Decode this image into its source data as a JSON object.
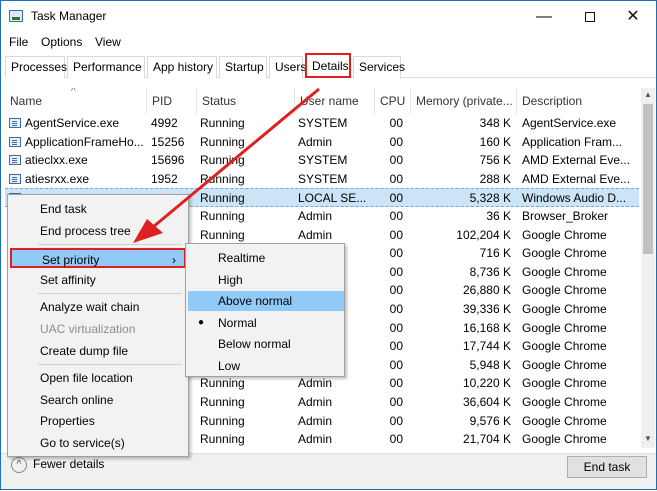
{
  "window": {
    "title": "Task Manager",
    "min": "—",
    "close": "✕"
  },
  "menu": [
    "File",
    "Options",
    "View"
  ],
  "tabs": [
    "Processes",
    "Performance",
    "App history",
    "Startup",
    "Users",
    "Details",
    "Services"
  ],
  "active_tab": "Details",
  "columns": [
    "Name",
    "PID",
    "Status",
    "User name",
    "CPU",
    "Memory (private...",
    "Description"
  ],
  "rows": [
    {
      "name": "AgentService.exe",
      "pid": "4992",
      "status": "Running",
      "user": "SYSTEM",
      "cpu": "00",
      "mem": "348 K",
      "desc": "AgentService.exe"
    },
    {
      "name": "ApplicationFrameHo...",
      "pid": "15256",
      "status": "Running",
      "user": "Admin",
      "cpu": "00",
      "mem": "160 K",
      "desc": "Application Fram..."
    },
    {
      "name": "atieclxx.exe",
      "pid": "15696",
      "status": "Running",
      "user": "SYSTEM",
      "cpu": "00",
      "mem": "756 K",
      "desc": "AMD External Eve..."
    },
    {
      "name": "atiesrxx.exe",
      "pid": "1952",
      "status": "Running",
      "user": "SYSTEM",
      "cpu": "00",
      "mem": "288 K",
      "desc": "AMD External Eve..."
    },
    {
      "name": "",
      "pid": "",
      "status": "Running",
      "user": "LOCAL SE...",
      "cpu": "00",
      "mem": "5,328 K",
      "desc": "Windows Audio D..."
    },
    {
      "name": "",
      "pid": "",
      "status": "Running",
      "user": "Admin",
      "cpu": "00",
      "mem": "36 K",
      "desc": "Browser_Broker"
    },
    {
      "name": "",
      "pid": "",
      "status": "Running",
      "user": "Admin",
      "cpu": "00",
      "mem": "102,204 K",
      "desc": "Google Chrome"
    },
    {
      "name": "",
      "pid": "",
      "status": "",
      "user": "",
      "cpu": "00",
      "mem": "716 K",
      "desc": "Google Chrome"
    },
    {
      "name": "",
      "pid": "",
      "status": "",
      "user": "",
      "cpu": "00",
      "mem": "8,736 K",
      "desc": "Google Chrome"
    },
    {
      "name": "",
      "pid": "",
      "status": "",
      "user": "",
      "cpu": "00",
      "mem": "26,880 K",
      "desc": "Google Chrome"
    },
    {
      "name": "",
      "pid": "",
      "status": "",
      "user": "",
      "cpu": "00",
      "mem": "39,336 K",
      "desc": "Google Chrome"
    },
    {
      "name": "",
      "pid": "",
      "status": "",
      "user": "",
      "cpu": "00",
      "mem": "16,168 K",
      "desc": "Google Chrome"
    },
    {
      "name": "",
      "pid": "",
      "status": "",
      "user": "",
      "cpu": "00",
      "mem": "17,744 K",
      "desc": "Google Chrome"
    },
    {
      "name": "",
      "pid": "",
      "status": "",
      "user": "",
      "cpu": "00",
      "mem": "5,948 K",
      "desc": "Google Chrome"
    },
    {
      "name": "",
      "pid": "",
      "status": "Running",
      "user": "Admin",
      "cpu": "00",
      "mem": "10,220 K",
      "desc": "Google Chrome"
    },
    {
      "name": "",
      "pid": "",
      "status": "Running",
      "user": "Admin",
      "cpu": "00",
      "mem": "36,604 K",
      "desc": "Google Chrome"
    },
    {
      "name": "",
      "pid": "",
      "status": "Running",
      "user": "Admin",
      "cpu": "00",
      "mem": "9,576 K",
      "desc": "Google Chrome"
    },
    {
      "name": "",
      "pid": "",
      "status": "Running",
      "user": "Admin",
      "cpu": "00",
      "mem": "21,704 K",
      "desc": "Google Chrome"
    }
  ],
  "selected_row": 4,
  "context_menu": [
    {
      "label": "End task"
    },
    {
      "label": "End process tree"
    },
    {
      "sep": true
    },
    {
      "label": "Set priority",
      "submenu": true,
      "highlight": true,
      "boxed": true
    },
    {
      "label": "Set affinity"
    },
    {
      "sep": true
    },
    {
      "label": "Analyze wait chain"
    },
    {
      "label": "UAC virtualization",
      "disabled": true
    },
    {
      "label": "Create dump file"
    },
    {
      "sep": true
    },
    {
      "label": "Open file location"
    },
    {
      "label": "Search online"
    },
    {
      "label": "Properties"
    },
    {
      "label": "Go to service(s)"
    }
  ],
  "priority_menu": [
    {
      "label": "Realtime"
    },
    {
      "label": "High"
    },
    {
      "label": "Above normal",
      "highlight": true
    },
    {
      "label": "Normal",
      "checked": true
    },
    {
      "label": "Below normal"
    },
    {
      "label": "Low"
    }
  ],
  "footer": {
    "fewer_details": "Fewer details",
    "end_task": "End task"
  },
  "colors": {
    "annotation": "#e02020",
    "selection": "#cce4f7",
    "menu_highlight": "#91c9f7"
  }
}
